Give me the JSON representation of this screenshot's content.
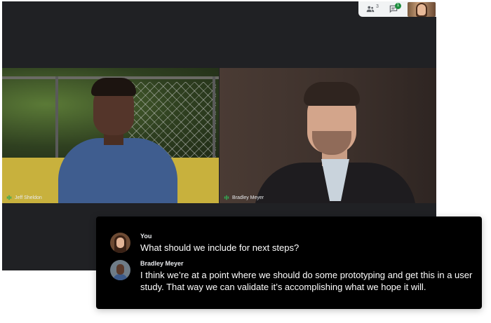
{
  "top_controls": {
    "participants_count": "3",
    "chat_badge": "1"
  },
  "participants": [
    {
      "name": "Jeff Sheldon"
    },
    {
      "name": "Bradley Meyer"
    }
  ],
  "chat": {
    "messages": [
      {
        "sender": "You",
        "text": "What should we include for next steps?"
      },
      {
        "sender": "Bradley Meyer",
        "text": "I think we’re at a point where we should do some prototyping and get this in a user study. That way we can validate it’s accomplishing what we hope it will."
      }
    ]
  }
}
